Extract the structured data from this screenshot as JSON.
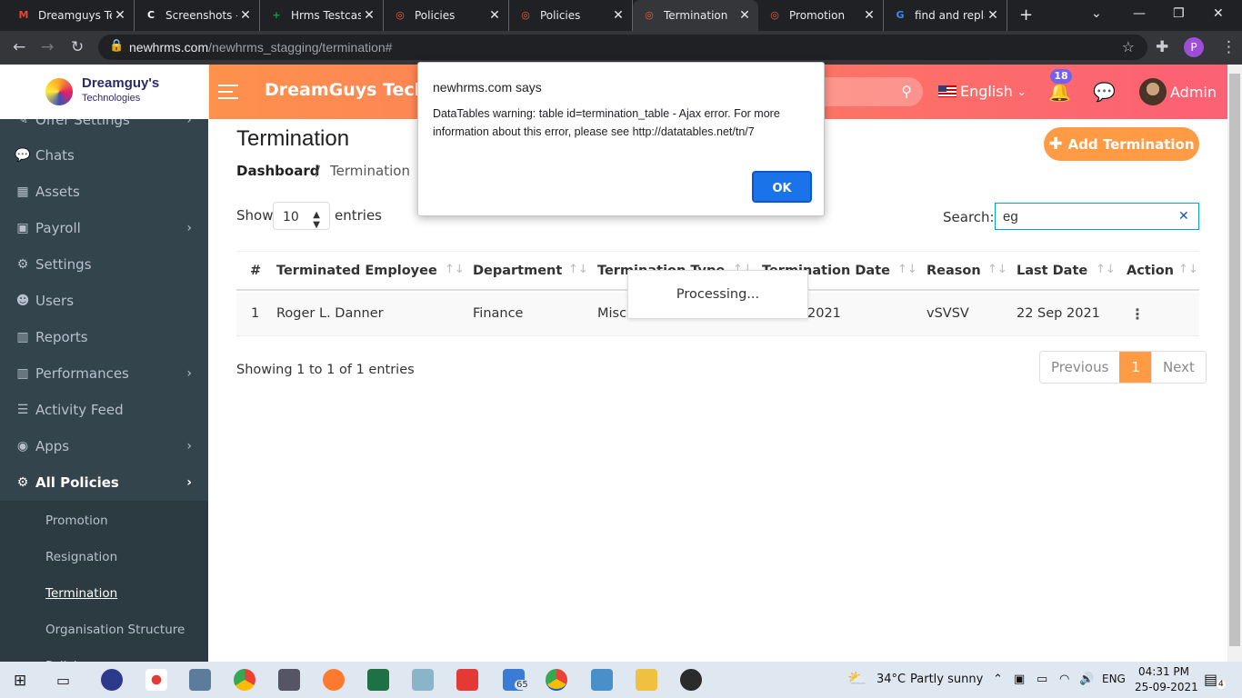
{
  "browser": {
    "tabs": [
      {
        "title": "Dreamguys Te",
        "icon": "gmail-icon",
        "color": "#ea4335",
        "glyph": "M"
      },
      {
        "title": "Screenshots -",
        "icon": "screenshot-icon",
        "color": "#ffffff",
        "glyph": "C"
      },
      {
        "title": "Hrms Testcas",
        "icon": "sheets-icon",
        "color": "#0f9d58",
        "glyph": "+"
      },
      {
        "title": "Policies",
        "icon": "site-icon",
        "color": "#e8603c",
        "glyph": "◎"
      },
      {
        "title": "Policies",
        "icon": "site-icon",
        "color": "#e8603c",
        "glyph": "◎"
      },
      {
        "title": "Termination",
        "icon": "site-icon",
        "color": "#e8603c",
        "glyph": "◎"
      },
      {
        "title": "Promotion",
        "icon": "site-icon",
        "color": "#e8603c",
        "glyph": "◎"
      },
      {
        "title": "find and repla",
        "icon": "google-icon",
        "color": "#4285f4",
        "glyph": "G"
      }
    ],
    "url_host": "newhrms.com",
    "url_path": "/newhrms_stagging/termination#",
    "profile_initial": "P"
  },
  "header": {
    "logo_line1": "Dreamguy's",
    "logo_line2": "Technologies",
    "brand": "DreamGuys Technologies",
    "language": "English",
    "notification_count": "18",
    "user": "Admin"
  },
  "sidebar": {
    "items": [
      {
        "label": "Offer Settings",
        "icon": "offer-icon",
        "glyph": "✎",
        "chevron": true
      },
      {
        "label": "Chats",
        "icon": "chat-icon",
        "glyph": "💬",
        "chevron": false
      },
      {
        "label": "Assets",
        "icon": "assets-icon",
        "glyph": "▦",
        "chevron": false
      },
      {
        "label": "Payroll",
        "icon": "payroll-icon",
        "glyph": "▣",
        "chevron": true
      },
      {
        "label": "Settings",
        "icon": "settings-icon",
        "glyph": "⚙",
        "chevron": false
      },
      {
        "label": "Users",
        "icon": "users-icon",
        "glyph": "☻",
        "chevron": false
      },
      {
        "label": "Reports",
        "icon": "reports-icon",
        "glyph": "▥",
        "chevron": false
      },
      {
        "label": "Performances",
        "icon": "performance-icon",
        "glyph": "▥",
        "chevron": true
      },
      {
        "label": "Activity Feed",
        "icon": "activity-icon",
        "glyph": "☰",
        "chevron": false
      },
      {
        "label": "Apps",
        "icon": "apps-icon",
        "glyph": "◉",
        "chevron": true
      },
      {
        "label": "All Policies",
        "icon": "policies-icon",
        "glyph": "⚙",
        "chevron": true
      }
    ],
    "submenu": [
      "Promotion",
      "Resignation",
      "Termination",
      "Organisation Structure",
      "Policies"
    ]
  },
  "page": {
    "title": "Termination",
    "breadcrumb_home": "Dashboard",
    "breadcrumb_sep": "/",
    "breadcrumb_current": "Termination",
    "add_button": "Add Termination",
    "show_label": "Show",
    "show_value": "10",
    "entries_label": "entries",
    "search_label": "Search:",
    "search_value": "eg",
    "columns": [
      "#",
      "Terminated Employee",
      "Department",
      "Termination Type",
      "Termination Date",
      "Reason",
      "Last Date",
      "Action"
    ],
    "rows": [
      {
        "num": "1",
        "employee": "Roger L. Danner",
        "department": "Finance",
        "type": "Misco",
        "date": "2021",
        "reason": "vSVSV",
        "last_date": "22 Sep 2021"
      }
    ],
    "processing": "Processing...",
    "showing": "Showing 1 to 1 of 1 entries",
    "pager": {
      "previous": "Previous",
      "current": "1",
      "next": "Next"
    }
  },
  "alert": {
    "title": "newhrms.com says",
    "message": "DataTables warning: table id=termination_table - Ajax error. For more information about this error, please see http://datatables.net/tn/7",
    "ok": "OK"
  },
  "taskbar": {
    "weather_temp": "34°C",
    "weather_text": "Partly sunny",
    "lang": "ENG",
    "time": "04:31 PM",
    "date": "25-09-2021",
    "notif_count": "4",
    "badge_65": "65"
  },
  "colors": {
    "accent": "#ff9b44",
    "header_end": "#fc6075",
    "sidebar": "#34444c",
    "ok_button": "#1a73e8"
  }
}
